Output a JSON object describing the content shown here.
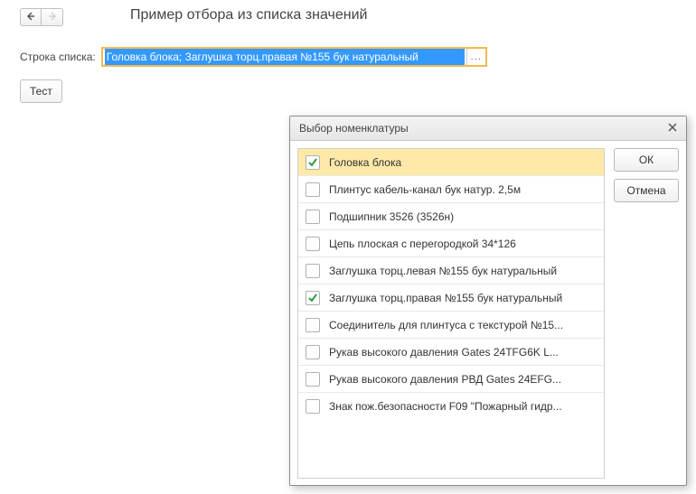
{
  "header": {
    "title": "Пример отбора из списка значений"
  },
  "field": {
    "label": "Строка списка:",
    "value": "Головка блока; Заглушка торц.правая №155 бук натуральный",
    "more": "..."
  },
  "testButton": "Тест",
  "dialog": {
    "title": "Выбор номенклатуры",
    "ok": "ОК",
    "cancel": "Отмена",
    "items": [
      {
        "label": "Головка блока",
        "checked": true,
        "selected": true
      },
      {
        "label": "Плинтус кабель-канал бук натур. 2,5м",
        "checked": false,
        "selected": false
      },
      {
        "label": "Подшипник 3526 (3526н)",
        "checked": false,
        "selected": false
      },
      {
        "label": "Цепь плоская с перегородкой 34*126",
        "checked": false,
        "selected": false
      },
      {
        "label": "Заглушка торц.левая №155 бук натуральный",
        "checked": false,
        "selected": false
      },
      {
        "label": "Заглушка торц.правая №155 бук натуральный",
        "checked": true,
        "selected": false
      },
      {
        "label": "Соединитель для плинтуса с текстурой №15...",
        "checked": false,
        "selected": false
      },
      {
        "label": "Рукав высокого давления Gates 24TFG6K L...",
        "checked": false,
        "selected": false
      },
      {
        "label": "Рукав высокого давления РВД Gates 24EFG...",
        "checked": false,
        "selected": false
      },
      {
        "label": "Знак пож.безопасности F09 \"Пожарный гидр...",
        "checked": false,
        "selected": false
      }
    ]
  }
}
